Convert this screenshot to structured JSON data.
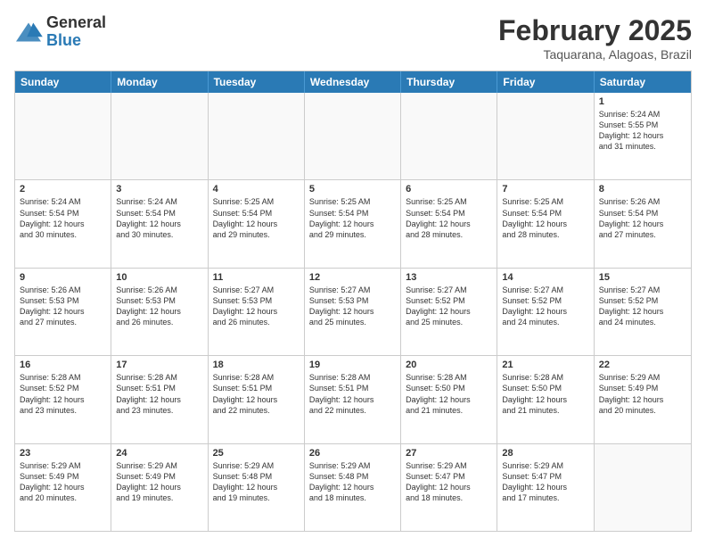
{
  "header": {
    "logo_general": "General",
    "logo_blue": "Blue",
    "month_year": "February 2025",
    "location": "Taquarana, Alagoas, Brazil"
  },
  "weekdays": [
    "Sunday",
    "Monday",
    "Tuesday",
    "Wednesday",
    "Thursday",
    "Friday",
    "Saturday"
  ],
  "rows": [
    [
      {
        "day": "",
        "info": ""
      },
      {
        "day": "",
        "info": ""
      },
      {
        "day": "",
        "info": ""
      },
      {
        "day": "",
        "info": ""
      },
      {
        "day": "",
        "info": ""
      },
      {
        "day": "",
        "info": ""
      },
      {
        "day": "1",
        "info": "Sunrise: 5:24 AM\nSunset: 5:55 PM\nDaylight: 12 hours\nand 31 minutes."
      }
    ],
    [
      {
        "day": "2",
        "info": "Sunrise: 5:24 AM\nSunset: 5:54 PM\nDaylight: 12 hours\nand 30 minutes."
      },
      {
        "day": "3",
        "info": "Sunrise: 5:24 AM\nSunset: 5:54 PM\nDaylight: 12 hours\nand 30 minutes."
      },
      {
        "day": "4",
        "info": "Sunrise: 5:25 AM\nSunset: 5:54 PM\nDaylight: 12 hours\nand 29 minutes."
      },
      {
        "day": "5",
        "info": "Sunrise: 5:25 AM\nSunset: 5:54 PM\nDaylight: 12 hours\nand 29 minutes."
      },
      {
        "day": "6",
        "info": "Sunrise: 5:25 AM\nSunset: 5:54 PM\nDaylight: 12 hours\nand 28 minutes."
      },
      {
        "day": "7",
        "info": "Sunrise: 5:25 AM\nSunset: 5:54 PM\nDaylight: 12 hours\nand 28 minutes."
      },
      {
        "day": "8",
        "info": "Sunrise: 5:26 AM\nSunset: 5:54 PM\nDaylight: 12 hours\nand 27 minutes."
      }
    ],
    [
      {
        "day": "9",
        "info": "Sunrise: 5:26 AM\nSunset: 5:53 PM\nDaylight: 12 hours\nand 27 minutes."
      },
      {
        "day": "10",
        "info": "Sunrise: 5:26 AM\nSunset: 5:53 PM\nDaylight: 12 hours\nand 26 minutes."
      },
      {
        "day": "11",
        "info": "Sunrise: 5:27 AM\nSunset: 5:53 PM\nDaylight: 12 hours\nand 26 minutes."
      },
      {
        "day": "12",
        "info": "Sunrise: 5:27 AM\nSunset: 5:53 PM\nDaylight: 12 hours\nand 25 minutes."
      },
      {
        "day": "13",
        "info": "Sunrise: 5:27 AM\nSunset: 5:52 PM\nDaylight: 12 hours\nand 25 minutes."
      },
      {
        "day": "14",
        "info": "Sunrise: 5:27 AM\nSunset: 5:52 PM\nDaylight: 12 hours\nand 24 minutes."
      },
      {
        "day": "15",
        "info": "Sunrise: 5:27 AM\nSunset: 5:52 PM\nDaylight: 12 hours\nand 24 minutes."
      }
    ],
    [
      {
        "day": "16",
        "info": "Sunrise: 5:28 AM\nSunset: 5:52 PM\nDaylight: 12 hours\nand 23 minutes."
      },
      {
        "day": "17",
        "info": "Sunrise: 5:28 AM\nSunset: 5:51 PM\nDaylight: 12 hours\nand 23 minutes."
      },
      {
        "day": "18",
        "info": "Sunrise: 5:28 AM\nSunset: 5:51 PM\nDaylight: 12 hours\nand 22 minutes."
      },
      {
        "day": "19",
        "info": "Sunrise: 5:28 AM\nSunset: 5:51 PM\nDaylight: 12 hours\nand 22 minutes."
      },
      {
        "day": "20",
        "info": "Sunrise: 5:28 AM\nSunset: 5:50 PM\nDaylight: 12 hours\nand 21 minutes."
      },
      {
        "day": "21",
        "info": "Sunrise: 5:28 AM\nSunset: 5:50 PM\nDaylight: 12 hours\nand 21 minutes."
      },
      {
        "day": "22",
        "info": "Sunrise: 5:29 AM\nSunset: 5:49 PM\nDaylight: 12 hours\nand 20 minutes."
      }
    ],
    [
      {
        "day": "23",
        "info": "Sunrise: 5:29 AM\nSunset: 5:49 PM\nDaylight: 12 hours\nand 20 minutes."
      },
      {
        "day": "24",
        "info": "Sunrise: 5:29 AM\nSunset: 5:49 PM\nDaylight: 12 hours\nand 19 minutes."
      },
      {
        "day": "25",
        "info": "Sunrise: 5:29 AM\nSunset: 5:48 PM\nDaylight: 12 hours\nand 19 minutes."
      },
      {
        "day": "26",
        "info": "Sunrise: 5:29 AM\nSunset: 5:48 PM\nDaylight: 12 hours\nand 18 minutes."
      },
      {
        "day": "27",
        "info": "Sunrise: 5:29 AM\nSunset: 5:47 PM\nDaylight: 12 hours\nand 18 minutes."
      },
      {
        "day": "28",
        "info": "Sunrise: 5:29 AM\nSunset: 5:47 PM\nDaylight: 12 hours\nand 17 minutes."
      },
      {
        "day": "",
        "info": ""
      }
    ]
  ]
}
